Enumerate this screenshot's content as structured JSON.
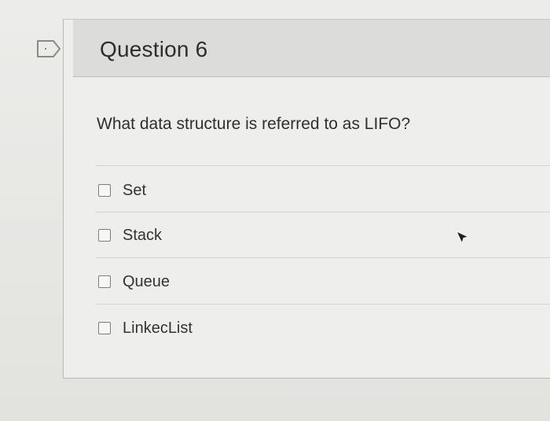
{
  "question": {
    "title": "Question 6",
    "text": "What data structure is referred to as LIFO?",
    "options": [
      {
        "label": "Set",
        "checked": false
      },
      {
        "label": "Stack",
        "checked": false
      },
      {
        "label": "Queue",
        "checked": false
      },
      {
        "label": "LinkecList",
        "checked": false
      }
    ]
  },
  "icons": {
    "flag": "flag-icon",
    "cursor": "mouse-pointer-icon"
  }
}
